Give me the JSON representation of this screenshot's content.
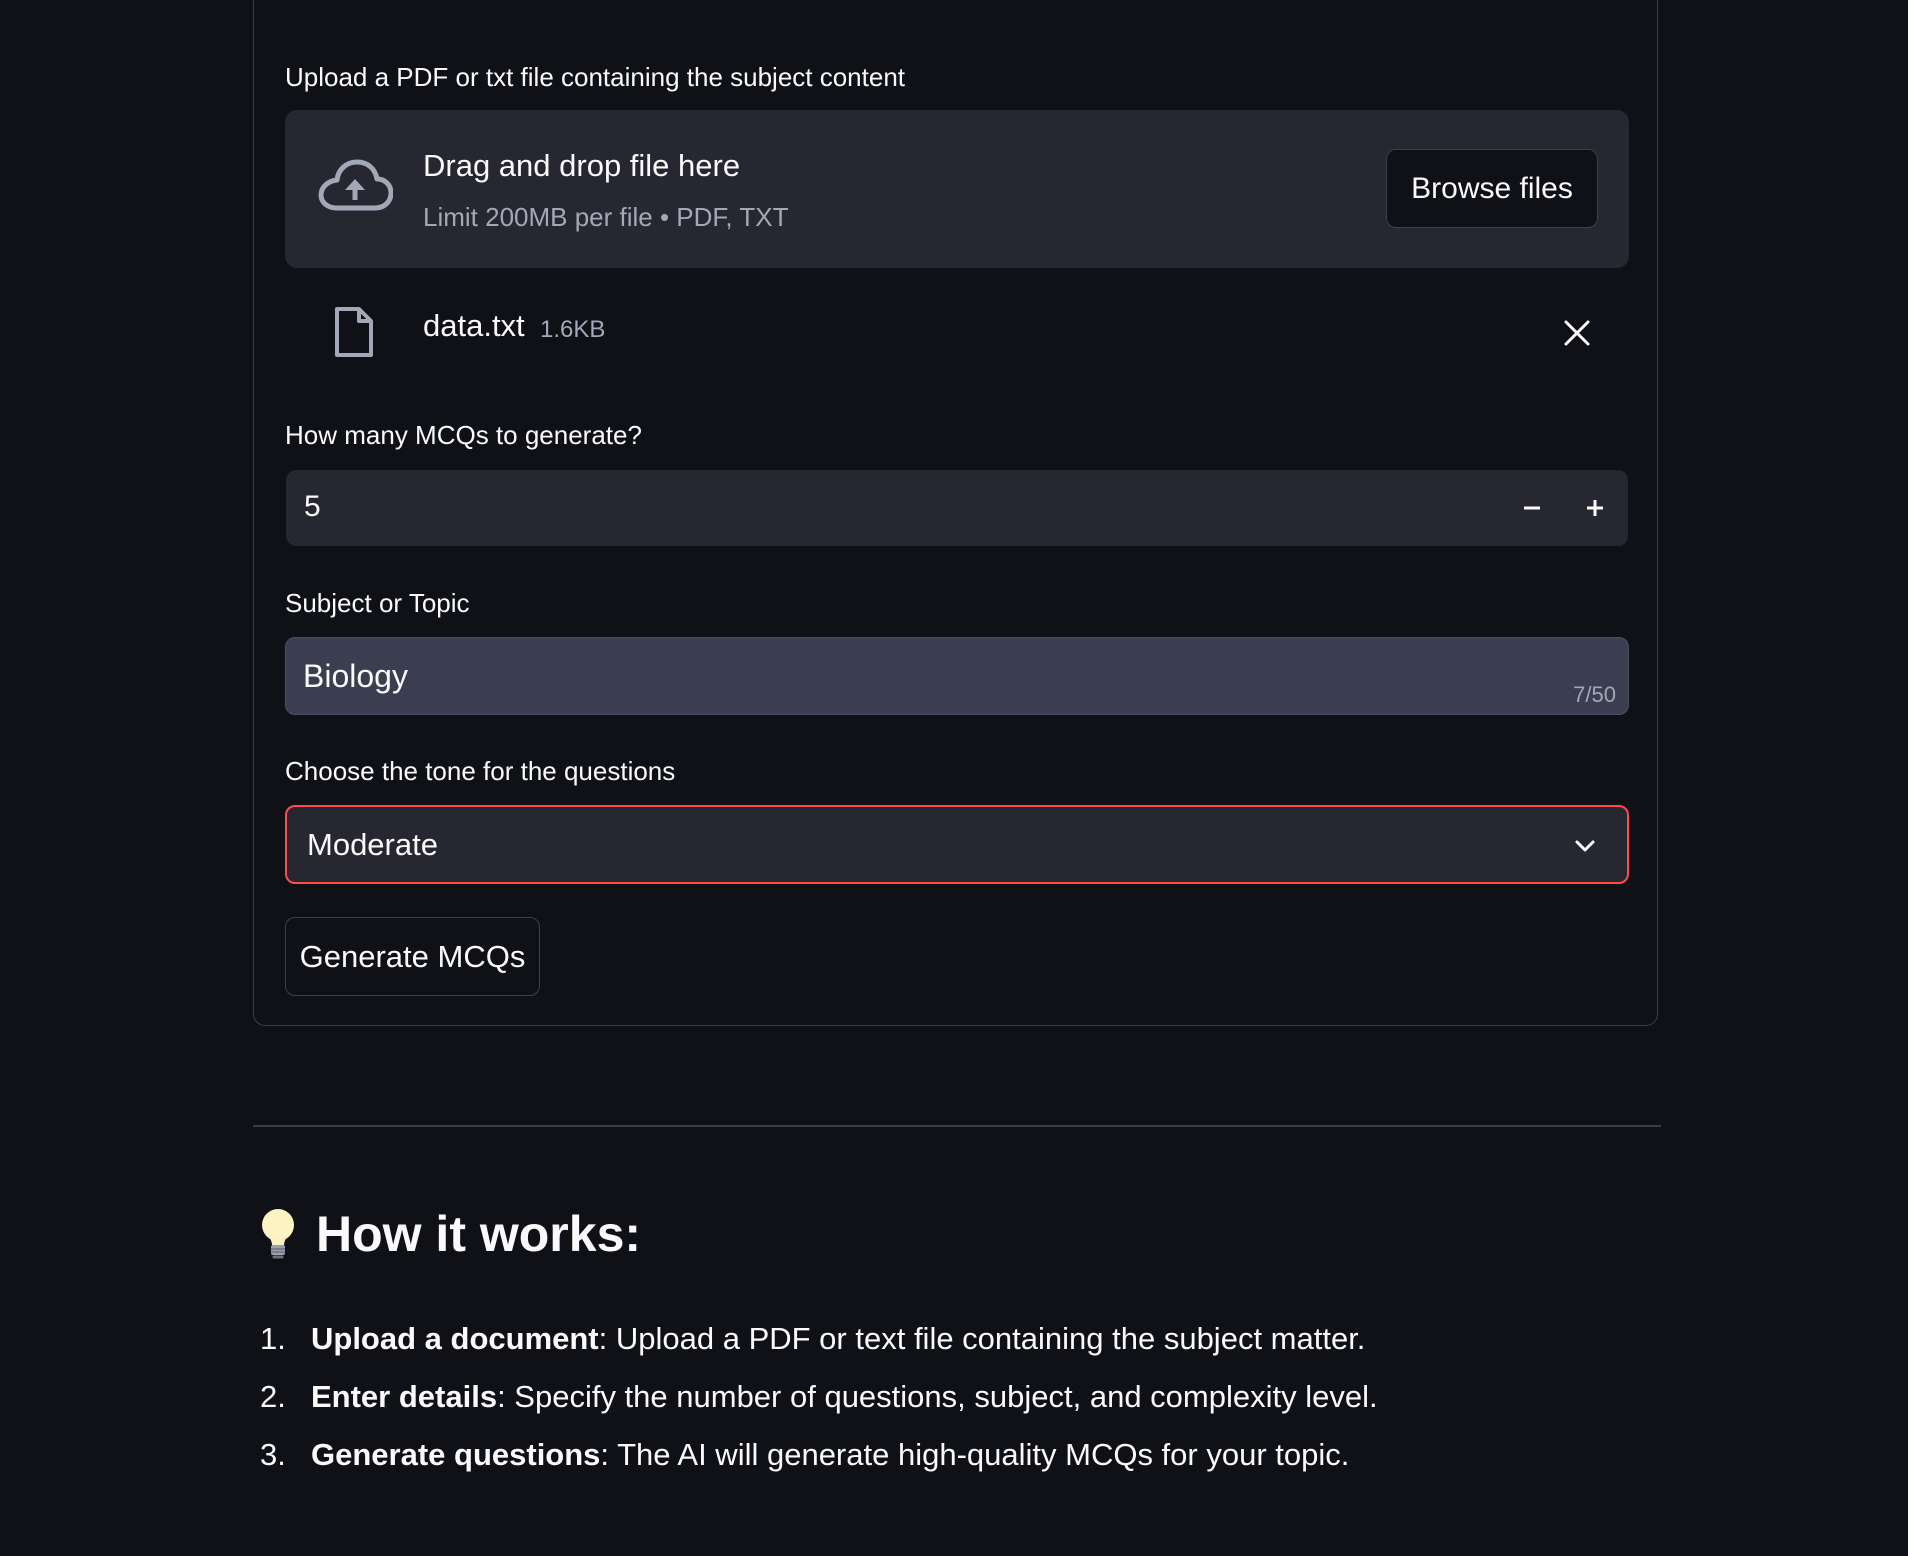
{
  "upload": {
    "label": "Upload a PDF or txt file containing the subject content",
    "dropzone_title": "Drag and drop file here",
    "dropzone_subtitle": "Limit 200MB per file • PDF, TXT",
    "browse_label": "Browse files",
    "file": {
      "name": "data.txt",
      "size": "1.6KB"
    }
  },
  "mcq_count": {
    "label": "How many MCQs to generate?",
    "value": "5",
    "decrement": "−",
    "increment": "+"
  },
  "subject": {
    "label": "Subject or Topic",
    "value": "Biology",
    "char_count": "7/50"
  },
  "tone": {
    "label": "Choose the tone for the questions",
    "selected": "Moderate"
  },
  "generate_button": "Generate MCQs",
  "how_it_works": {
    "icon": "lightbulb-icon",
    "title": "How it works:",
    "steps": [
      {
        "num": "1.",
        "bold": "Upload a document",
        "text": ": Upload a PDF or text file containing the subject matter."
      },
      {
        "num": "2.",
        "bold": "Enter details",
        "text": ": Specify the number of questions, subject, and complexity level."
      },
      {
        "num": "3.",
        "bold": "Generate questions",
        "text": ": The AI will generate high-quality MCQs for your topic."
      }
    ]
  },
  "colors": {
    "background": "#0f1117",
    "panel": "#262730",
    "accent_border": "#ff4b4b",
    "muted_text": "#a3a8b8"
  }
}
